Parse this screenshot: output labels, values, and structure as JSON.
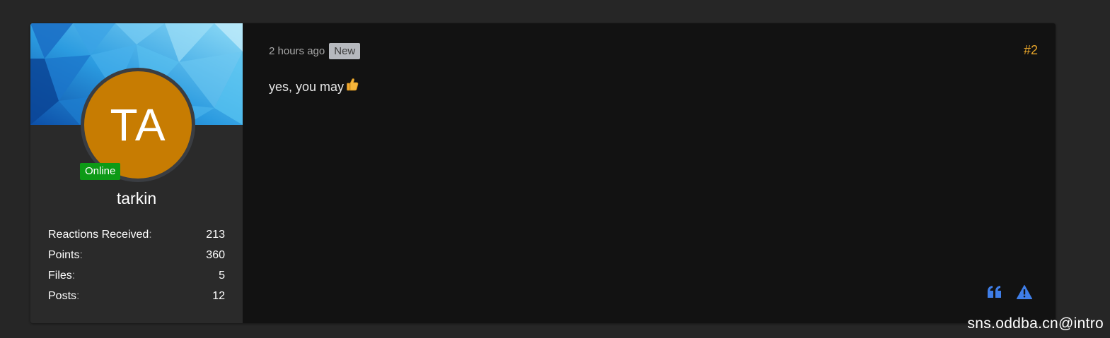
{
  "user": {
    "avatar_initials": "TA",
    "avatar_color": "#c77c02",
    "status": "Online",
    "status_color": "#0d9a16",
    "username": "tarkin",
    "stats": [
      {
        "label": "Reactions Received",
        "value": "213"
      },
      {
        "label": "Points",
        "value": "360"
      },
      {
        "label": "Files",
        "value": "5"
      },
      {
        "label": "Posts",
        "value": "12"
      }
    ]
  },
  "post": {
    "timestamp": "2 hours ago",
    "badge": "New",
    "number": "#2",
    "number_color": "#e6a42a",
    "message": "yes, you may",
    "message_emoji": "thumbs-up-icon",
    "actions": [
      {
        "name": "quote-button",
        "icon": "quote-icon"
      },
      {
        "name": "report-button",
        "icon": "warning-icon"
      }
    ],
    "action_color": "#3f7ee8"
  },
  "watermark": "sns.oddba.cn@intro"
}
